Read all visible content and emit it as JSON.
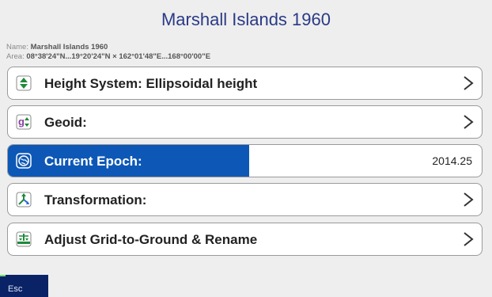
{
  "header": {
    "title": "Marshall Islands 1960",
    "name_label": "Name:",
    "name_value": "Marshall Islands 1960",
    "area_label": "Area:",
    "area_value": "08°38'24\"N...19°20'24\"N × 162°01'48\"E...168°00'00\"E"
  },
  "rows": [
    {
      "label": "Height System: Ellipsoidal height",
      "icon": "height-system-icon"
    },
    {
      "label": "Geoid:",
      "icon": "geoid-icon"
    },
    {
      "label": "Current Epoch:",
      "value": "2014.25",
      "icon": "globe-icon",
      "active": true,
      "progress": 0.5
    },
    {
      "label": "Transformation:",
      "icon": "transformation-icon"
    },
    {
      "label": "Adjust Grid-to-Ground & Rename",
      "icon": "grid-to-ground-icon"
    }
  ],
  "footer": {
    "esc_label": "Esc"
  },
  "colors": {
    "accent": "#0d58b6",
    "title": "#2a3a86",
    "esc_bg": "#0a2367"
  }
}
